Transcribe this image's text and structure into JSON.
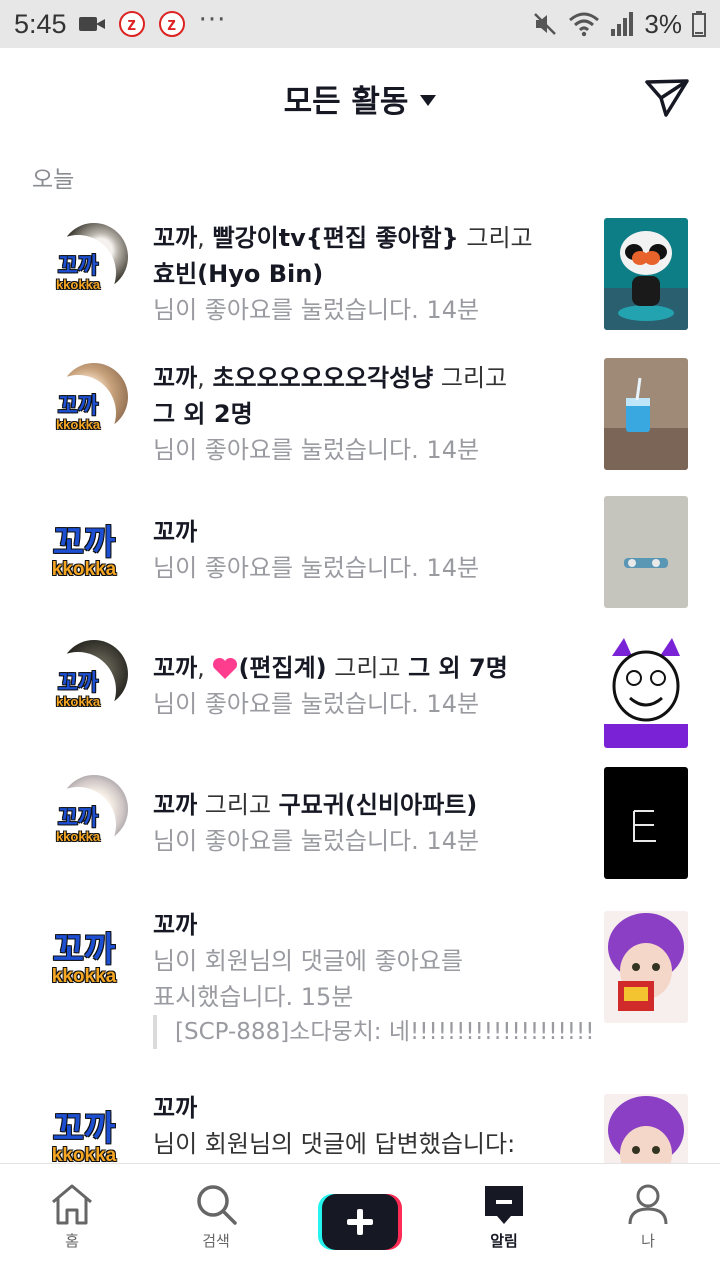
{
  "status_bar": {
    "time": "5:45",
    "battery": "3%",
    "icons": [
      "video-icon",
      "notification-z-icon",
      "notification-z-icon",
      "more-dots-icon",
      "mute-icon",
      "wifi-icon",
      "signal-icon",
      "battery-icon"
    ]
  },
  "header": {
    "title": "모든 활동",
    "dropdown_icon": "caret-down-icon",
    "send_icon": "send-icon"
  },
  "section_label": "오늘",
  "logo": {
    "main": "꼬까",
    "sub": "kkokka"
  },
  "notifications": [
    {
      "name1": "꼬까",
      "sep1": ", ",
      "name2": "빨강이tv{편집 좋아함}",
      "connector": " 그리고",
      "name3": "효빈(Hyo Bin)",
      "action": "님이 좋아요를 눌렀습니다.",
      "time": "14분"
    },
    {
      "name1": "꼬까",
      "sep1": ", ",
      "name2": "초오오오오오오각성냥",
      "connector": " 그리고",
      "name3": "그 외 2명",
      "action": "님이 좋아요를 눌렀습니다.",
      "time": "14분"
    },
    {
      "name1": "꼬까",
      "action": "님이 좋아요를 눌렀습니다.",
      "time": "14분"
    },
    {
      "name1": "꼬까",
      "sep1": ", ",
      "name2": "(편집계)",
      "heart_icon": "pink-heart-emoji",
      "connector": " 그리고 ",
      "name3": "그 외 7명",
      "action": "님이 좋아요를 눌렀습니다.",
      "time": "14분"
    },
    {
      "name1": "꼬까",
      "connector": " 그리고 ",
      "name2": "구묘귀(신비아파트)",
      "action": "님이 좋아요를 눌렀습니다.",
      "time": "14분"
    },
    {
      "name1": "꼬까",
      "action_line1": "님이 회원님의 댓글에 좋아요를",
      "action_line2": "표시했습니다.",
      "time": "15분",
      "quote": "[SCP-888]소다뭉치: 네!!!!!!!!!!!!!!!!!!!!"
    },
    {
      "name1": "꼬까",
      "action_line1": "님이 회원님의 댓글에 답변했습니다:"
    }
  ],
  "bottom_nav": {
    "home": "홈",
    "search": "검색",
    "create_icon": "plus-icon",
    "inbox": "알림",
    "profile": "나"
  }
}
